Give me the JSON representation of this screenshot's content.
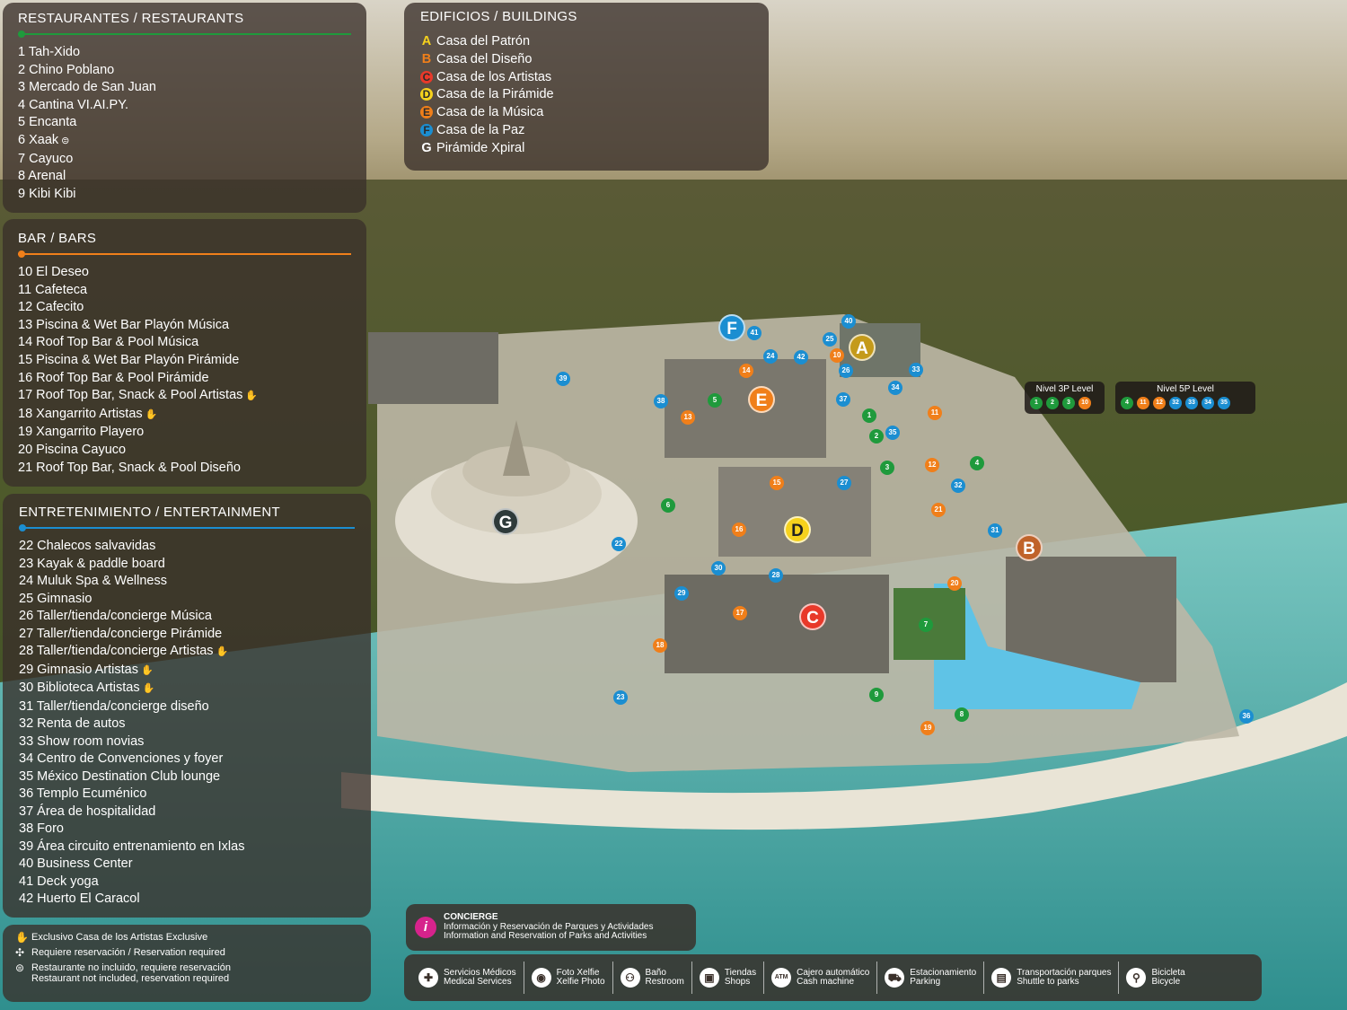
{
  "colors": {
    "green": "#1f9a3c",
    "orange": "#f07f1a",
    "blue": "#1b8ed1",
    "yellow": "#f6d21d",
    "red": "#e8392a",
    "brown": "#b26a2e",
    "dark": "#3a302a"
  },
  "restaurants": {
    "title": "RESTAURANTES / RESTAURANTS",
    "items": [
      {
        "num": "1",
        "name": "Tah-Xido"
      },
      {
        "num": "2",
        "name": "Chino Poblano"
      },
      {
        "num": "3",
        "name": "Mercado de San Juan"
      },
      {
        "num": "4",
        "name": "Cantina VI.AI.PY."
      },
      {
        "num": "5",
        "name": "Encanta"
      },
      {
        "num": "6",
        "name": "Xaak",
        "icon": "not-included-icon"
      },
      {
        "num": "7",
        "name": "Cayuco"
      },
      {
        "num": "8",
        "name": "Arenal"
      },
      {
        "num": "9",
        "name": "Kibi Kibi"
      }
    ]
  },
  "bars": {
    "title": "BAR / BARS",
    "items": [
      {
        "num": "10",
        "name": "El Deseo"
      },
      {
        "num": "11",
        "name": "Cafeteca"
      },
      {
        "num": "12",
        "name": "Cafecito"
      },
      {
        "num": "13",
        "name": "Piscina & Wet Bar Playón Música"
      },
      {
        "num": "14",
        "name": "Roof Top Bar & Pool Música"
      },
      {
        "num": "15",
        "name": "Piscina & Wet Bar Playón Pirámide"
      },
      {
        "num": "16",
        "name": "Roof Top Bar & Pool Pirámide"
      },
      {
        "num": "17",
        "name": "Roof Top Bar, Snack & Pool Artistas",
        "icon": "hand-icon"
      },
      {
        "num": "18",
        "name": "Xangarrito Artistas",
        "icon": "hand-icon"
      },
      {
        "num": "19",
        "name": "Xangarrito Playero"
      },
      {
        "num": "20",
        "name": "Piscina Cayuco"
      },
      {
        "num": "21",
        "name": "Roof Top Bar, Snack & Pool Diseño"
      }
    ]
  },
  "entertainment": {
    "title": "ENTRETENIMIENTO / ENTERTAINMENT",
    "items": [
      {
        "num": "22",
        "name": "Chalecos salvavidas"
      },
      {
        "num": "23",
        "name": "Kayak & paddle board"
      },
      {
        "num": "24",
        "name": "Muluk Spa & Wellness"
      },
      {
        "num": "25",
        "name": "Gimnasio"
      },
      {
        "num": "26",
        "name": "Taller/tienda/concierge Música"
      },
      {
        "num": "27",
        "name": "Taller/tienda/concierge Pirámide"
      },
      {
        "num": "28",
        "name": "Taller/tienda/concierge Artistas",
        "icon": "hand-icon"
      },
      {
        "num": "29",
        "name": "Gimnasio Artistas",
        "icon": "hand-icon"
      },
      {
        "num": "30",
        "name": "Biblioteca Artistas",
        "icon": "hand-icon"
      },
      {
        "num": "31",
        "name": "Taller/tienda/concierge diseño"
      },
      {
        "num": "32",
        "name": "Renta de autos"
      },
      {
        "num": "33",
        "name": "Show room novias"
      },
      {
        "num": "34",
        "name": "Centro de Convenciones y foyer"
      },
      {
        "num": "35",
        "name": "México Destination Club lounge"
      },
      {
        "num": "36",
        "name": "Templo Ecuménico"
      },
      {
        "num": "37",
        "name": "Área de hospitalidad"
      },
      {
        "num": "38",
        "name": "Foro"
      },
      {
        "num": "39",
        "name": "Área circuito entrenamiento en Ixlas"
      },
      {
        "num": "40",
        "name": "Business Center"
      },
      {
        "num": "41",
        "name": "Deck yoga"
      },
      {
        "num": "42",
        "name": "Huerto El Caracol"
      }
    ]
  },
  "legend": [
    {
      "icon": "hand-icon",
      "text": "Exclusivo Casa de los Artistas Exclusive"
    },
    {
      "icon": "reservation-icon",
      "text": "Requiere reservación / Reservation required"
    },
    {
      "icon": "not-included-icon",
      "text": "Restaurante no incluido, requiere reservación",
      "text2": "Restaurant not included, reservation required"
    }
  ],
  "buildings": {
    "title": "EDIFICIOS / BUILDINGS",
    "items": [
      {
        "letter": "A",
        "name": "Casa del Patrón",
        "color": "#f6d21d",
        "style": "plain"
      },
      {
        "letter": "B",
        "name": "Casa del Diseño",
        "color": "#f07f1a",
        "style": "plain"
      },
      {
        "letter": "C",
        "name": "Casa de los Artistas",
        "color": "#e8392a",
        "style": "circle"
      },
      {
        "letter": "D",
        "name": "Casa de la Pirámide",
        "color": "#f6d21d",
        "style": "circle"
      },
      {
        "letter": "E",
        "name": "Casa de la Música",
        "color": "#f07f1a",
        "style": "circle"
      },
      {
        "letter": "F",
        "name": "Casa de la Paz",
        "color": "#1b8ed1",
        "style": "circle"
      },
      {
        "letter": "G",
        "name": "Pirámide Xpiral",
        "color": "#ffffff",
        "style": "plain"
      }
    ]
  },
  "levels": [
    {
      "id": "lvl3",
      "title": "Nivel 3P Level",
      "dots": [
        {
          "n": "1",
          "c": "green"
        },
        {
          "n": "2",
          "c": "green"
        },
        {
          "n": "3",
          "c": "green"
        },
        {
          "n": "10",
          "c": "orange"
        }
      ]
    },
    {
      "id": "lvl5",
      "title": "Nivel 5P Level",
      "dots": [
        {
          "n": "4",
          "c": "green"
        },
        {
          "n": "11",
          "c": "orange"
        },
        {
          "n": "12",
          "c": "orange"
        },
        {
          "n": "32",
          "c": "blue"
        },
        {
          "n": "33",
          "c": "blue"
        },
        {
          "n": "34",
          "c": "blue"
        },
        {
          "n": "35",
          "c": "blue"
        }
      ]
    }
  ],
  "concierge": {
    "title": "CONCIERGE",
    "line1": "Información y Reservación de Parques y Actividades",
    "line2": "Information and Reservation of Parks and Activities",
    "icon_label": "i"
  },
  "services": [
    {
      "icon": "plus-icon",
      "glyph": "✚",
      "es": "Servicios Médicos",
      "en": "Medical Services"
    },
    {
      "icon": "camera-icon",
      "glyph": "◉",
      "es": "Foto Xelfie",
      "en": "Xelfie Photo"
    },
    {
      "icon": "restroom-icon",
      "glyph": "⚇",
      "es": "Baño",
      "en": "Restroom"
    },
    {
      "icon": "shopping-bag-icon",
      "glyph": "▣",
      "es": "Tiendas",
      "en": "Shops"
    },
    {
      "icon": "atm-icon",
      "glyph": "ATM",
      "es": "Cajero automático",
      "en": "Cash machine"
    },
    {
      "icon": "car-icon",
      "glyph": "⛟",
      "es": "Estacionamiento",
      "en": "Parking"
    },
    {
      "icon": "bus-icon",
      "glyph": "▤",
      "es": "Transportación parques",
      "en": "Shuttle to parks"
    },
    {
      "icon": "bicycle-icon",
      "glyph": "⚲",
      "es": "Bicicleta",
      "en": "Bicycle"
    }
  ],
  "map_markers": [
    {
      "label": "A",
      "type": "big",
      "color": "#c49a1a"
    },
    {
      "label": "B",
      "type": "big",
      "color": "#c0632a"
    },
    {
      "label": "C",
      "type": "big",
      "color": "#e8392a"
    },
    {
      "label": "D",
      "type": "big",
      "color": "#f6d21d"
    },
    {
      "label": "E",
      "type": "big",
      "color": "#f07f1a"
    },
    {
      "label": "F",
      "type": "big",
      "color": "#1b8ed1"
    },
    {
      "label": "G",
      "type": "big",
      "color": "#2e3a3a"
    },
    {
      "label": "1",
      "type": "small",
      "color": "#1f9a3c"
    },
    {
      "label": "2",
      "type": "small",
      "color": "#1f9a3c"
    },
    {
      "label": "3",
      "type": "small",
      "color": "#1f9a3c"
    },
    {
      "label": "4",
      "type": "small",
      "color": "#1f9a3c"
    },
    {
      "label": "5",
      "type": "small",
      "color": "#1f9a3c"
    },
    {
      "label": "6",
      "type": "small",
      "color": "#1f9a3c"
    },
    {
      "label": "7",
      "type": "small",
      "color": "#1f9a3c"
    },
    {
      "label": "8",
      "type": "small",
      "color": "#1f9a3c"
    },
    {
      "label": "9",
      "type": "small",
      "color": "#1f9a3c"
    },
    {
      "label": "10",
      "type": "small",
      "color": "#f07f1a"
    },
    {
      "label": "11",
      "type": "small",
      "color": "#f07f1a"
    },
    {
      "label": "12",
      "type": "small",
      "color": "#f07f1a"
    },
    {
      "label": "13",
      "type": "small",
      "color": "#f07f1a"
    },
    {
      "label": "14",
      "type": "small",
      "color": "#f07f1a"
    },
    {
      "label": "15",
      "type": "small",
      "color": "#f07f1a"
    },
    {
      "label": "16",
      "type": "small",
      "color": "#f07f1a"
    },
    {
      "label": "17",
      "type": "small",
      "color": "#f07f1a"
    },
    {
      "label": "18",
      "type": "small",
      "color": "#f07f1a"
    },
    {
      "label": "19",
      "type": "small",
      "color": "#f07f1a"
    },
    {
      "label": "20",
      "type": "small",
      "color": "#f07f1a"
    },
    {
      "label": "21",
      "type": "small",
      "color": "#f07f1a"
    },
    {
      "label": "22",
      "type": "small",
      "color": "#1b8ed1"
    },
    {
      "label": "23",
      "type": "small",
      "color": "#1b8ed1"
    },
    {
      "label": "24",
      "type": "small",
      "color": "#1b8ed1"
    },
    {
      "label": "25",
      "type": "small",
      "color": "#1b8ed1"
    },
    {
      "label": "26",
      "type": "small",
      "color": "#1b8ed1"
    },
    {
      "label": "27",
      "type": "small",
      "color": "#1b8ed1"
    },
    {
      "label": "28",
      "type": "small",
      "color": "#1b8ed1"
    },
    {
      "label": "29",
      "type": "small",
      "color": "#1b8ed1"
    },
    {
      "label": "30",
      "type": "small",
      "color": "#1b8ed1"
    },
    {
      "label": "31",
      "type": "small",
      "color": "#1b8ed1"
    },
    {
      "label": "32",
      "type": "small",
      "color": "#1b8ed1"
    },
    {
      "label": "33",
      "type": "small",
      "color": "#1b8ed1"
    },
    {
      "label": "34",
      "type": "small",
      "color": "#1b8ed1"
    },
    {
      "label": "35",
      "type": "small",
      "color": "#1b8ed1"
    },
    {
      "label": "36",
      "type": "small",
      "color": "#1b8ed1"
    },
    {
      "label": "37",
      "type": "small",
      "color": "#1b8ed1"
    },
    {
      "label": "38",
      "type": "small",
      "color": "#1b8ed1"
    },
    {
      "label": "39",
      "type": "small",
      "color": "#1b8ed1"
    },
    {
      "label": "40",
      "type": "small",
      "color": "#1b8ed1"
    },
    {
      "label": "41",
      "type": "small",
      "color": "#1b8ed1"
    },
    {
      "label": "42",
      "type": "small",
      "color": "#1b8ed1"
    }
  ]
}
